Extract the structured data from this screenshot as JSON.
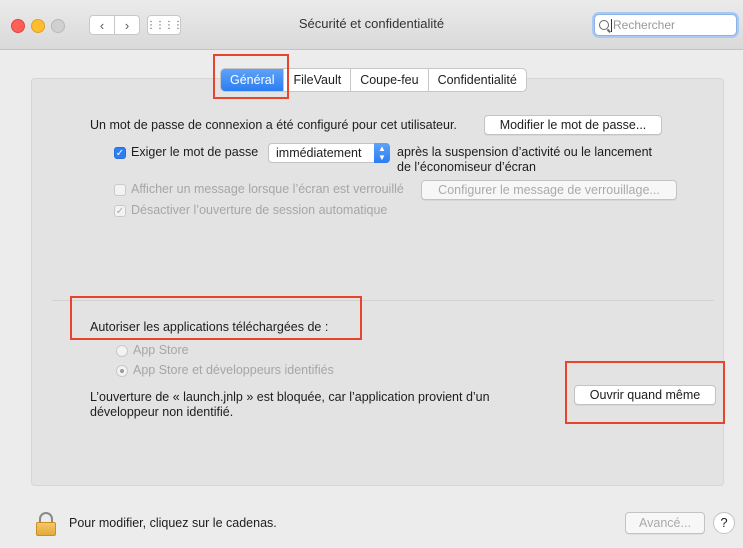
{
  "window": {
    "title": "Sécurité et confidentialité"
  },
  "toolbar": {
    "back_icon": "‹",
    "forward_icon": "›",
    "grid_icon": "⋮⋮⋮⋮",
    "search_placeholder": "Rechercher"
  },
  "tabs": [
    {
      "label": "Général",
      "active": true
    },
    {
      "label": "FileVault",
      "active": false
    },
    {
      "label": "Coupe-feu",
      "active": false
    },
    {
      "label": "Confidentialité",
      "active": false
    }
  ],
  "password": {
    "configured_text": "Un mot de passe de connexion a été configuré pour cet utilisateur.",
    "change_button": "Modifier le mot de passe...",
    "require_label": "Exiger le mot de passe",
    "require_value": "immédiatement",
    "after_text_1": "après la suspension d’activité ou le lancement",
    "after_text_2": "de l’économiseur d’écran",
    "show_message_label": "Afficher un message lorsque l’écran est verrouillé",
    "configure_message_button": "Configurer le message de verrouillage...",
    "disable_autologin_label": "Désactiver l’ouverture de session automatique"
  },
  "apps": {
    "heading": "Autoriser les applications téléchargées de :",
    "option_app_store": "App Store",
    "option_identified": "App Store et développeurs identifiés",
    "blocked_text_1": "L’ouverture de « launch.jnlp » est bloquée, car l’application provient d’un",
    "blocked_text_2": "développeur non identifié.",
    "open_anyway_button": "Ouvrir quand même"
  },
  "footer": {
    "lock_text": "Pour modifier, cliquez sur le cadenas.",
    "advanced_button": "Avancé...",
    "help_label": "?"
  },
  "colors": {
    "accent": "#2d7ef3",
    "highlight": "#e8432c"
  }
}
